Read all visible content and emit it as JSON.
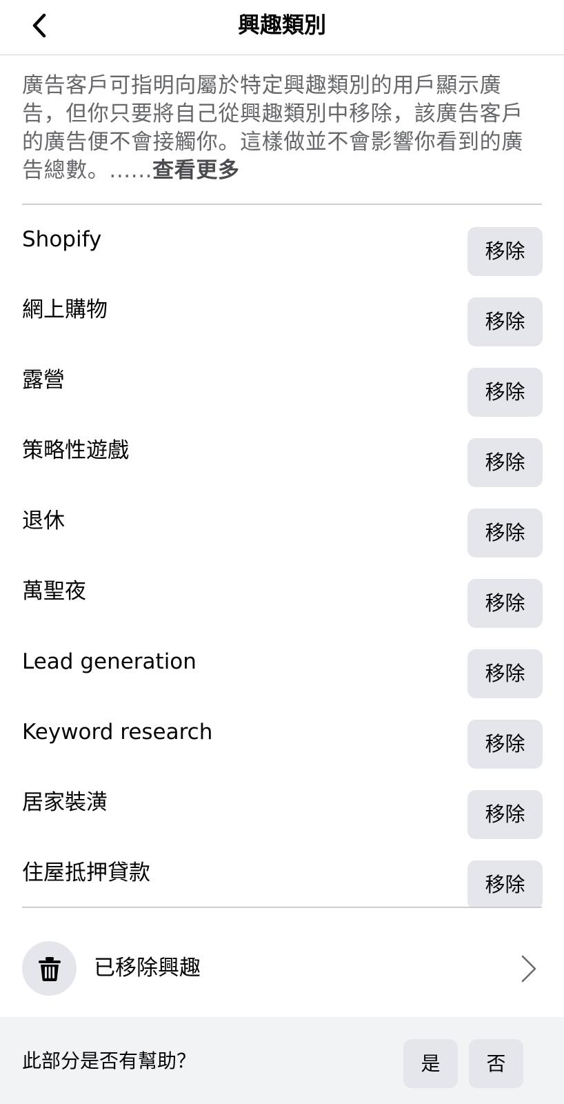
{
  "header": {
    "title": "興趣類別",
    "back_icon": "chevron-left-icon"
  },
  "description": {
    "text": "廣告客戶可指明向屬於特定興趣類別的用戶顯示廣告，但你只要將自己從興趣類別中移除，該廣告客戶的廣告便不會接觸你。這樣做並不會影響你看到的廣告總數。......",
    "see_more": "查看更多"
  },
  "interests": [
    {
      "label": "Shopify",
      "action": "移除"
    },
    {
      "label": "網上購物",
      "action": "移除"
    },
    {
      "label": "露營",
      "action": "移除"
    },
    {
      "label": "策略性遊戲",
      "action": "移除"
    },
    {
      "label": "退休",
      "action": "移除"
    },
    {
      "label": "萬聖夜",
      "action": "移除"
    },
    {
      "label": "Lead generation",
      "action": "移除"
    },
    {
      "label": "Keyword research",
      "action": "移除"
    },
    {
      "label": "居家裝潢",
      "action": "移除"
    },
    {
      "label": "住屋抵押貸款",
      "action": "移除"
    }
  ],
  "removed_interests": {
    "label": "已移除興趣",
    "icon": "trash-icon",
    "chevron": "chevron-right-icon"
  },
  "feedback": {
    "question": "此部分是否有幫助？",
    "yes": "是",
    "no": "否"
  },
  "colors": {
    "button_bg": "#e4e6eb",
    "secondary_text": "#65676b",
    "footer_bg": "#f2f3f5",
    "divider": "#cbcdd1"
  }
}
